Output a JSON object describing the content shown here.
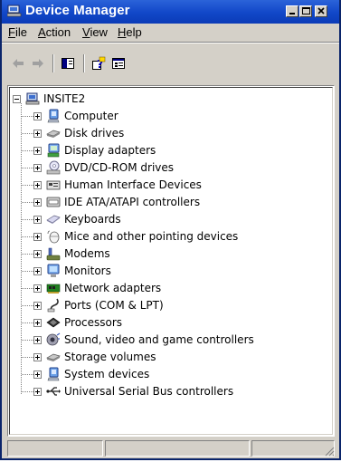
{
  "window": {
    "title": "Device Manager"
  },
  "menu": {
    "items": [
      {
        "label": "File",
        "accel": "F",
        "rest": "ile"
      },
      {
        "label": "Action",
        "accel": "A",
        "rest": "ction"
      },
      {
        "label": "View",
        "accel": "V",
        "rest": "iew"
      },
      {
        "label": "Help",
        "accel": "H",
        "rest": "elp"
      }
    ]
  },
  "tree": {
    "root": {
      "label": "INSITE2",
      "expanded": true
    },
    "categories": [
      "Computer",
      "Disk drives",
      "Display adapters",
      "DVD/CD-ROM drives",
      "Human Interface Devices",
      "IDE ATA/ATAPI controllers",
      "Keyboards",
      "Mice and other pointing devices",
      "Modems",
      "Monitors",
      "Network adapters",
      "Ports (COM & LPT)",
      "Processors",
      "Sound, video and game controllers",
      "Storage volumes",
      "System devices",
      "Universal Serial Bus controllers"
    ]
  },
  "icons": {
    "categories": [
      "computer-icon",
      "disk-drive-icon",
      "display-adapter-icon",
      "dvd-drive-icon",
      "hid-icon",
      "ide-controller-icon",
      "keyboard-icon",
      "mouse-icon",
      "modem-icon",
      "monitor-icon",
      "network-adapter-icon",
      "port-icon",
      "processor-icon",
      "sound-icon",
      "storage-volume-icon",
      "system-device-icon",
      "usb-icon"
    ]
  },
  "colors": {
    "titlebar": "#0b3bb7",
    "face": "#d4d0c8"
  }
}
